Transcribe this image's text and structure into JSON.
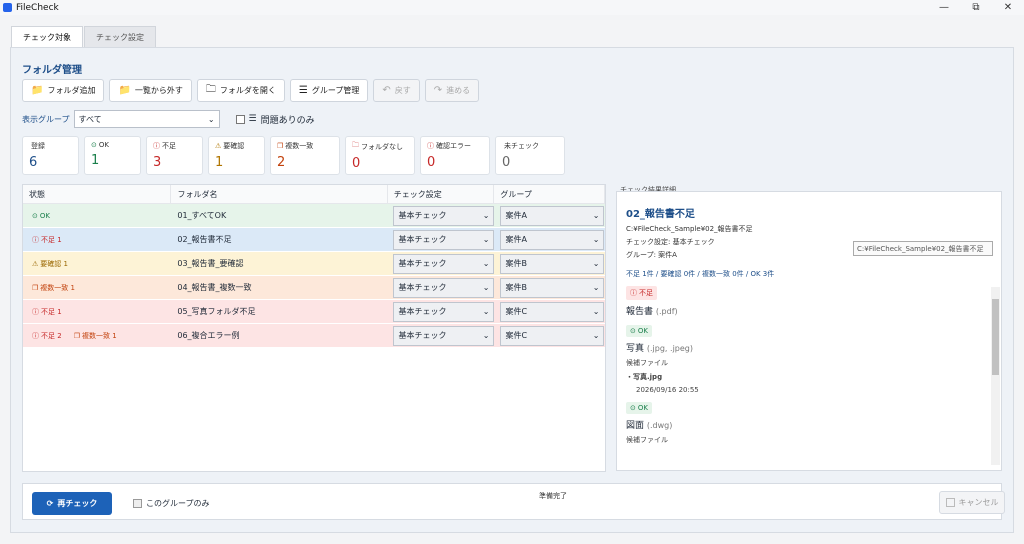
{
  "window": {
    "title": "FileCheck",
    "min": "—",
    "max": "⧉",
    "close": "✕"
  },
  "tabs": [
    {
      "label": "チェック対象"
    },
    {
      "label": "チェック設定"
    }
  ],
  "section_title": "フォルダ管理",
  "toolbar": [
    {
      "label": "フォルダ追加",
      "icon": "📁"
    },
    {
      "label": "一覧から外す",
      "icon": "📁"
    },
    {
      "label": "フォルダを開く",
      "icon": "🗀"
    },
    {
      "label": "グループ管理",
      "icon": "☰"
    },
    {
      "label": "戻す",
      "icon": "↶"
    },
    {
      "label": "進める",
      "icon": "↷"
    }
  ],
  "filter": {
    "label": "表示グループ",
    "selected": "すべて",
    "problems_only": "問題ありのみ"
  },
  "stats": [
    {
      "label": "登録",
      "value": "6",
      "color": "#1d4e89",
      "icon": ""
    },
    {
      "label": "OK",
      "value": "1",
      "color": "#1a7f4b",
      "icon": "⊙"
    },
    {
      "label": "不足",
      "value": "3",
      "color": "#c62828",
      "icon": "ⓘ"
    },
    {
      "label": "要確認",
      "value": "1",
      "color": "#b07500",
      "icon": "⚠"
    },
    {
      "label": "複数一致",
      "value": "2",
      "color": "#c2410c",
      "icon": "❐"
    },
    {
      "label": "フォルダなし",
      "value": "0",
      "color": "#c62828",
      "icon": "🗀"
    },
    {
      "label": "確認エラー",
      "value": "0",
      "color": "#c62828",
      "icon": "ⓘ"
    },
    {
      "label": "未チェック",
      "value": "0",
      "color": "#666666",
      "icon": ""
    }
  ],
  "table": {
    "headers": [
      "状態",
      "フォルダ名",
      "チェック設定",
      "グループ"
    ],
    "rows": [
      {
        "status": [
          "OK"
        ],
        "status_icons": [
          "⊙"
        ],
        "name": "01_すべてOK",
        "setting": "基本チェック",
        "group": "案件A",
        "bg": "#e6f4ea",
        "badge_colors": [
          "#1a7f4b"
        ]
      },
      {
        "status": [
          "不足 1"
        ],
        "status_icons": [
          "ⓘ"
        ],
        "name": "02_報告書不足",
        "setting": "基本チェック",
        "group": "案件A",
        "bg": "#dbe9f7",
        "badge_colors": [
          "#c62828"
        ]
      },
      {
        "status": [
          "要確認 1"
        ],
        "status_icons": [
          "⚠"
        ],
        "name": "03_報告書_要確認",
        "setting": "基本チェック",
        "group": "案件B",
        "bg": "#fdf3d6",
        "badge_colors": [
          "#9a6700"
        ]
      },
      {
        "status": [
          "複数一致 1"
        ],
        "status_icons": [
          "❐"
        ],
        "name": "04_報告書_複数一致",
        "setting": "基本チェック",
        "group": "案件B",
        "bg": "#fde8da",
        "badge_colors": [
          "#c2410c"
        ]
      },
      {
        "status": [
          "不足 1"
        ],
        "status_icons": [
          "ⓘ"
        ],
        "name": "05_写真フォルダ不足",
        "setting": "基本チェック",
        "group": "案件C",
        "bg": "#fde4e4",
        "badge_colors": [
          "#c62828"
        ]
      },
      {
        "status": [
          "不足 2",
          "複数一致 1"
        ],
        "status_icons": [
          "ⓘ",
          "❐"
        ],
        "name": "06_複合エラー例",
        "setting": "基本チェック",
        "group": "案件C",
        "bg": "#fde4e4",
        "badge_colors": [
          "#c62828",
          "#c2410c"
        ]
      }
    ]
  },
  "detail": {
    "section_label": "チェック結果詳細",
    "title": "02_報告書不足",
    "path": "C:¥FileCheck_Sample¥02_報告書不足",
    "setting": "チェック設定: 基本チェック",
    "group": "グループ: 案件A",
    "tooltip": "C:¥FileCheck_Sample¥02_報告書不足",
    "summary": "不足 1件 / 要確認 0件 / 複数一致 0件 / OK 3件",
    "items": [
      {
        "badge": "不足",
        "badge_icon": "ⓘ",
        "badge_color": "#c62828",
        "badge_bg": "#fde4e4",
        "name": "報告書",
        "ext": "(.pdf)",
        "sub": []
      },
      {
        "badge": "OK",
        "badge_icon": "⊙",
        "badge_color": "#1a7f4b",
        "badge_bg": "#e6f4ea",
        "name": "写真",
        "ext": "(.jpg, .jpeg)",
        "sub": [
          "候補ファイル",
          "・写真.jpg",
          "2026/09/16 20:55"
        ]
      },
      {
        "badge": "OK",
        "badge_icon": "⊙",
        "badge_color": "#1a7f4b",
        "badge_bg": "#e6f4ea",
        "name": "図面",
        "ext": "(.dwg)",
        "sub": [
          "候補ファイル"
        ]
      }
    ]
  },
  "bottom": {
    "recheck": "再チェック",
    "group_only": "このグループのみ",
    "status": "準備完了",
    "cancel": "キャンセル"
  }
}
